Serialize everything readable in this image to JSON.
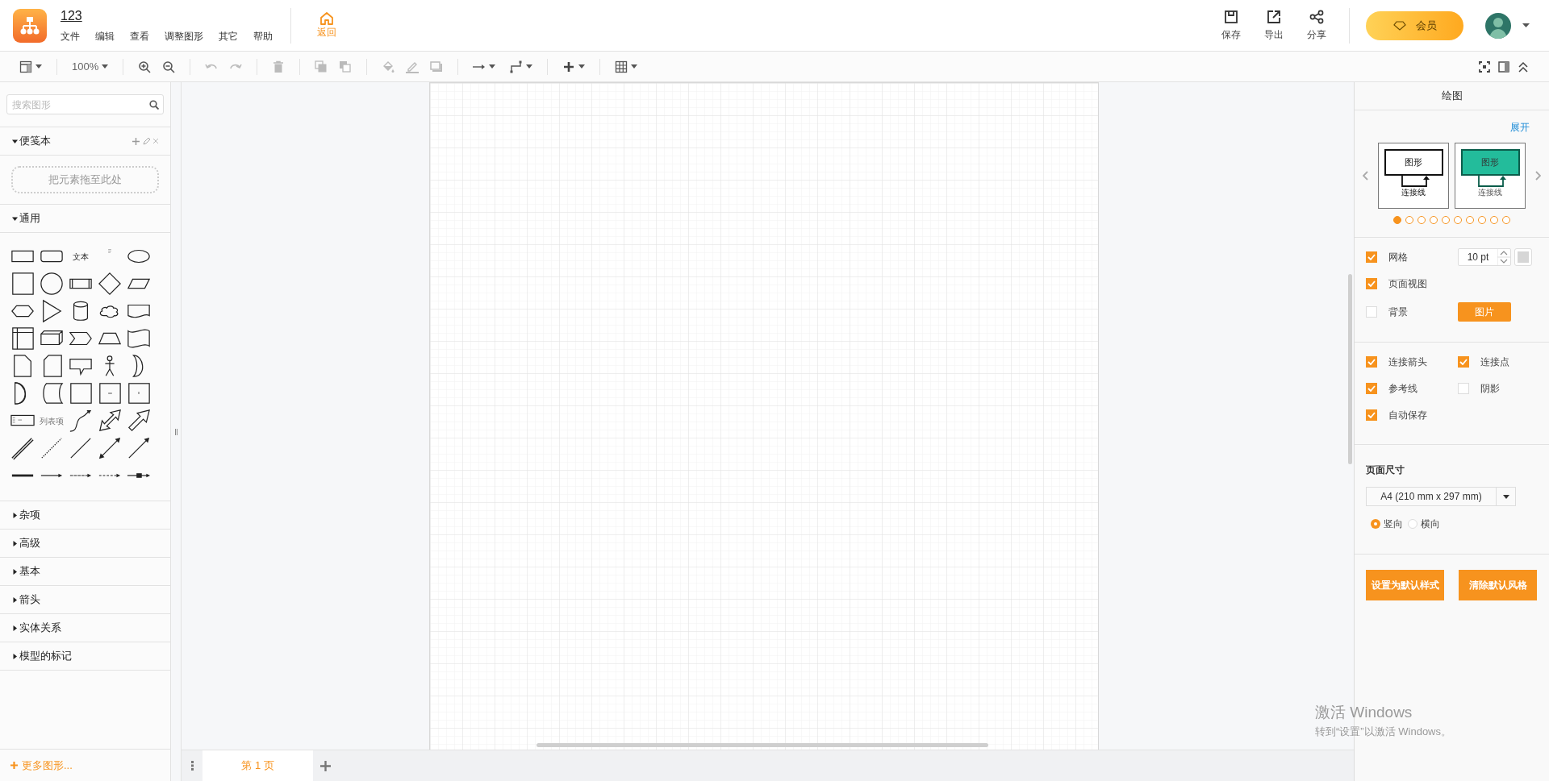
{
  "app": {
    "title": "123",
    "menus": [
      "文件",
      "编辑",
      "查看",
      "调整图形",
      "其它",
      "帮助"
    ],
    "home": "返回"
  },
  "actions": [
    "保存",
    "导出",
    "分享"
  ],
  "member_button": "会员",
  "toolbar": {
    "zoom": "100%"
  },
  "sidebar": {
    "search_placeholder": "搜索图形",
    "scratchpad": {
      "title": "便笺本",
      "expanded": true,
      "drop_hint": "把元素拖至此处"
    },
    "general": {
      "title": "通用",
      "expanded": true,
      "shape_labels": [
        "文本",
        "列表项"
      ]
    },
    "sections": [
      {
        "title": "杂项",
        "expanded": false
      },
      {
        "title": "高级",
        "expanded": false
      },
      {
        "title": "基本",
        "expanded": false
      },
      {
        "title": "箭头",
        "expanded": false
      },
      {
        "title": "实体关系",
        "expanded": false
      },
      {
        "title": "模型的标记",
        "expanded": false
      }
    ],
    "more": "更多图形..."
  },
  "pages": [
    {
      "label": "第 1 页",
      "selected": true
    }
  ],
  "format_panel": {
    "title": "绘图",
    "expand_link": "展开",
    "styles": [
      {
        "shape_label": "图形",
        "line_label": "连接线",
        "color": "#ffffff"
      },
      {
        "shape_label": "图形",
        "line_label": "连接线",
        "color": "#23bc9b"
      }
    ],
    "style_pages": [
      {
        "selected": true
      },
      {
        "selected": false
      },
      {
        "selected": false
      },
      {
        "selected": false
      },
      {
        "selected": false
      },
      {
        "selected": false
      },
      {
        "selected": false
      },
      {
        "selected": false
      },
      {
        "selected": false
      },
      {
        "selected": false
      }
    ],
    "grid": {
      "label": "网格",
      "checked": true,
      "value": "10 pt"
    },
    "page_view": {
      "label": "页面视图",
      "checked": true
    },
    "background": {
      "label": "背景",
      "checked": false,
      "button": "图片"
    },
    "options": [
      {
        "label": "连接箭头",
        "checked": true
      },
      {
        "label": "连接点",
        "checked": true
      },
      {
        "label": "参考线",
        "checked": true
      },
      {
        "label": "阴影",
        "checked": false
      },
      {
        "label": "自动保存",
        "checked": true
      }
    ],
    "page_size": {
      "title": "页面尺寸",
      "value": "A4 (210 mm x 297 mm)",
      "orientations": [
        {
          "label": "竖向",
          "selected": true
        },
        {
          "label": "横向",
          "selected": false
        }
      ]
    },
    "buttons": [
      "设置为默认样式",
      "清除默认风格"
    ]
  },
  "os_notice": {
    "title": "激活 Windows",
    "hint": "转到“设置”以激活 Windows。"
  }
}
